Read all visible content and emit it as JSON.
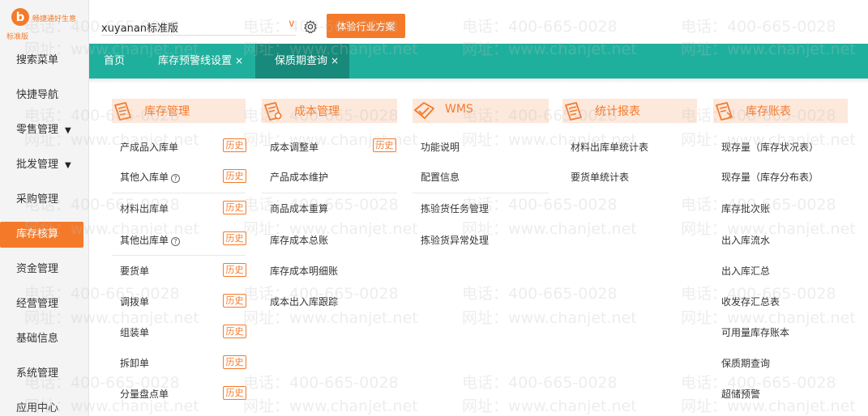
{
  "logo": {
    "badge": "b",
    "slogan": "畅捷通好生意",
    "edition": "标准版"
  },
  "sidebar": {
    "items": [
      {
        "label": "搜索菜单",
        "caret": ""
      },
      {
        "label": "快捷导航",
        "caret": ""
      },
      {
        "label": "零售管理",
        "caret": "▼"
      },
      {
        "label": "批发管理",
        "caret": "▼"
      },
      {
        "label": "采购管理",
        "caret": ""
      },
      {
        "label": "库存核算",
        "caret": ""
      },
      {
        "label": "资金管理",
        "caret": ""
      },
      {
        "label": "经营管理",
        "caret": ""
      },
      {
        "label": "基础信息",
        "caret": ""
      },
      {
        "label": "系统管理",
        "caret": ""
      },
      {
        "label": "应用中心",
        "caret": ""
      }
    ],
    "active_index": 5
  },
  "header": {
    "company": "xuyanan标准版",
    "company_chevron": "∨",
    "solution_button": "体验行业方案"
  },
  "tabs": [
    {
      "label": "首页",
      "close": ""
    },
    {
      "label": "库存预警线设置",
      "close": "×"
    },
    {
      "label": "保质期查询",
      "close": "×"
    }
  ],
  "modules": {
    "inventory": {
      "title": "库存管理",
      "history_label": "历史",
      "items": [
        "产成品入库单",
        "其他入库单",
        "材料出库单",
        "其他出库单",
        "要货单",
        "调拨单",
        "组装单",
        "拆卸单",
        "分量盘点单"
      ],
      "help_mark": "?"
    },
    "cost": {
      "title": "成本管理",
      "history_label": "历史",
      "items": [
        "成本调整单",
        "产品成本维护",
        "商品成本重算",
        "库存成本总账",
        "库存成本明细账",
        "成本出入库跟踪"
      ]
    },
    "wms": {
      "title": "WMS",
      "items": [
        "功能说明",
        "配置信息",
        "拣验货任务管理",
        "拣验货异常处理"
      ]
    },
    "reports": {
      "title": "统计报表",
      "items": [
        "材料出库单统计表",
        "要货单统计表"
      ]
    },
    "ledger": {
      "title": "库存账表",
      "items": [
        "现存量（库存状况表）",
        "现存量（库存分布表）",
        "库存批次账",
        "出入库流水",
        "出入库汇总",
        "收发存汇总表",
        "可用量库存账本",
        "保质期查询",
        "超储预警"
      ]
    }
  },
  "watermark": {
    "phone": "电话：400-665-0028",
    "site": "网址：www.chanjet.net"
  },
  "colors": {
    "accent": "#f47a2a",
    "tabbar": "#1fb09d",
    "tab_active": "#178a7b",
    "module_header_bg": "#fde8dc"
  }
}
